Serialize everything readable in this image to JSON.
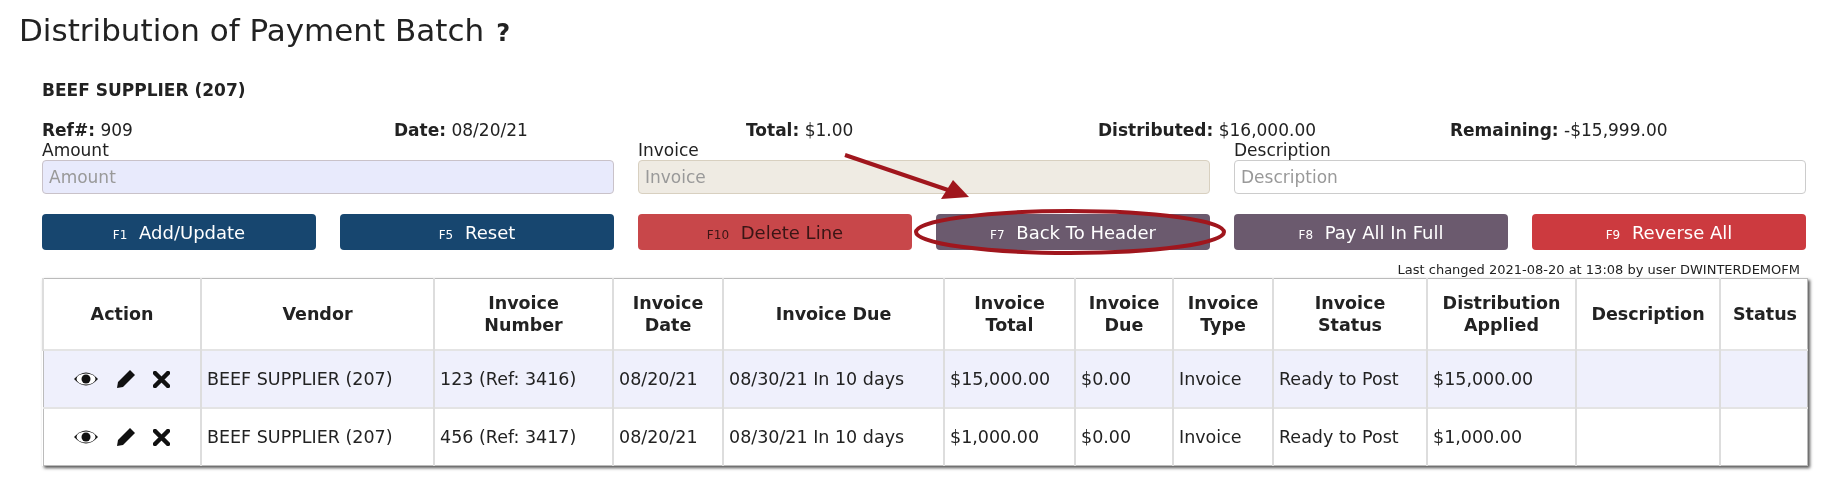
{
  "page": {
    "title": "Distribution of Payment Batch",
    "help": "?"
  },
  "vendor": "BEEF SUPPLIER (207)",
  "summary": [
    {
      "label": "Ref#:",
      "value": "909"
    },
    {
      "label": "Date:",
      "value": "08/20/21"
    },
    {
      "label": "Total:",
      "value": "$1.00"
    },
    {
      "label": "Distributed:",
      "value": "$16,000.00"
    },
    {
      "label": "Remaining:",
      "value": "-$15,999.00"
    }
  ],
  "fields": [
    {
      "label": "Amount",
      "placeholder": "Amount",
      "highlighted": true,
      "disabled": false
    },
    {
      "label": "Invoice",
      "placeholder": "Invoice",
      "highlighted": false,
      "disabled": true
    },
    {
      "label": "Description",
      "placeholder": "Description",
      "highlighted": false,
      "disabled": false
    }
  ],
  "buttons": [
    {
      "key": "F1",
      "label": "Add/Update",
      "kind": "primary"
    },
    {
      "key": "F5",
      "label": "Reset",
      "kind": "primary"
    },
    {
      "key": "F10",
      "label": "Delete Line",
      "kind": "warning"
    },
    {
      "key": "F7",
      "label": "Back To Header",
      "kind": "secondary"
    },
    {
      "key": "F8",
      "label": "Pay All In Full",
      "kind": "secondary"
    },
    {
      "key": "F9",
      "label": "Reverse All",
      "kind": "danger"
    }
  ],
  "last_changed": "Last changed 2021-08-20 at 13:08 by user DWINTERDEMOFM",
  "table": {
    "columns": [
      "Action",
      "Vendor",
      "Invoice Number",
      "Invoice Date",
      "Invoice Due",
      "Invoice Total",
      "Invoice Due",
      "Invoice Type",
      "Invoice Status",
      "Distribution Applied",
      "Description",
      "Status"
    ],
    "rows": [
      {
        "selected": true,
        "cells": [
          {
            "kind": "actions"
          },
          "BEEF SUPPLIER (207)",
          "123 (Ref: 3416)",
          "08/20/21",
          "08/30/21 In 10 days",
          "$15,000.00",
          "$0.00",
          "Invoice",
          "Ready to Post",
          "$15,000.00"
        ]
      },
      {
        "selected": false,
        "cells": [
          {
            "kind": "actions"
          },
          "BEEF SUPPLIER (207)",
          "456 (Ref: 3417)",
          "08/20/21",
          "08/30/21 In 10 days",
          "$1,000.00",
          "$0.00",
          "Invoice",
          "Ready to Post",
          "$1,000.00"
        ]
      }
    ]
  }
}
